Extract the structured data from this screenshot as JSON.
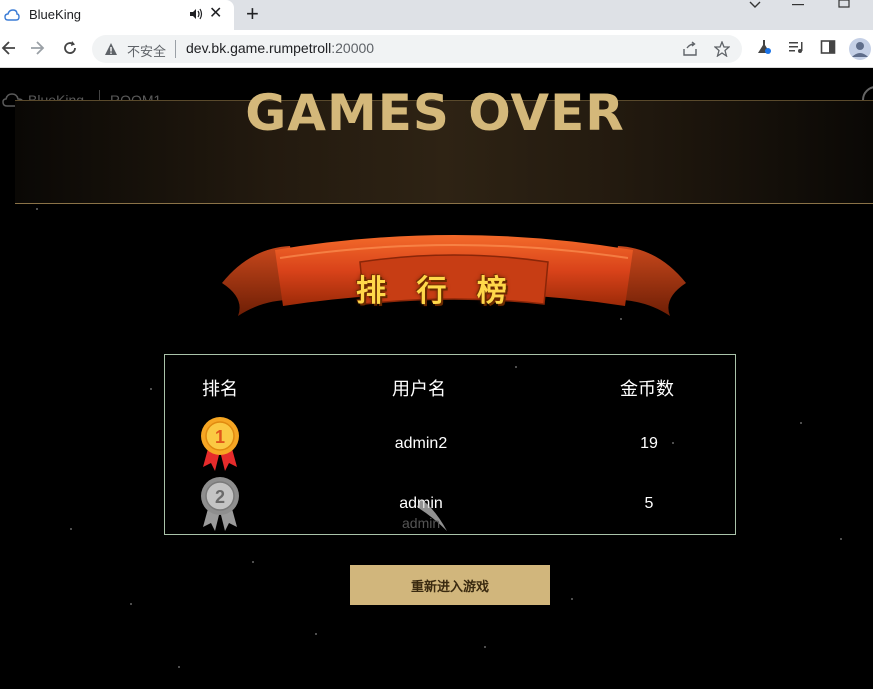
{
  "browser": {
    "tab_title": "BlueKing",
    "close_glyph": "✕",
    "new_tab_glyph": "+",
    "security_label": "不安全",
    "url_host": "dev.bk.game.rumpetroll",
    "url_port": ":20000",
    "icons": [
      "back-icon",
      "forward-icon",
      "reload-icon",
      "warning-icon",
      "share-icon",
      "star-icon",
      "labs-icon",
      "media-icon",
      "sidepanel-icon",
      "profile-icon"
    ]
  },
  "hud": {
    "brand": "BlueKing",
    "room": "ROOM1"
  },
  "game": {
    "title": "GAMES OVER",
    "ribbon_label": "排 行 榜",
    "table": {
      "headers": [
        "排名",
        "用户名",
        "金币数"
      ],
      "rows": [
        {
          "rank": "1",
          "medal": "gold-medal",
          "username": "admin2",
          "coins": "19"
        },
        {
          "rank": "2",
          "medal": "silver-medal",
          "username": "admin",
          "coins": "5"
        }
      ],
      "ghost_label": "admin"
    },
    "restart_label": "重新进入游戏"
  },
  "colors": {
    "title_gold": "#d4b87a",
    "button_bg": "#d1b67c",
    "board_border": "#a9c2a9",
    "ribbon_red": "#e14a16"
  }
}
